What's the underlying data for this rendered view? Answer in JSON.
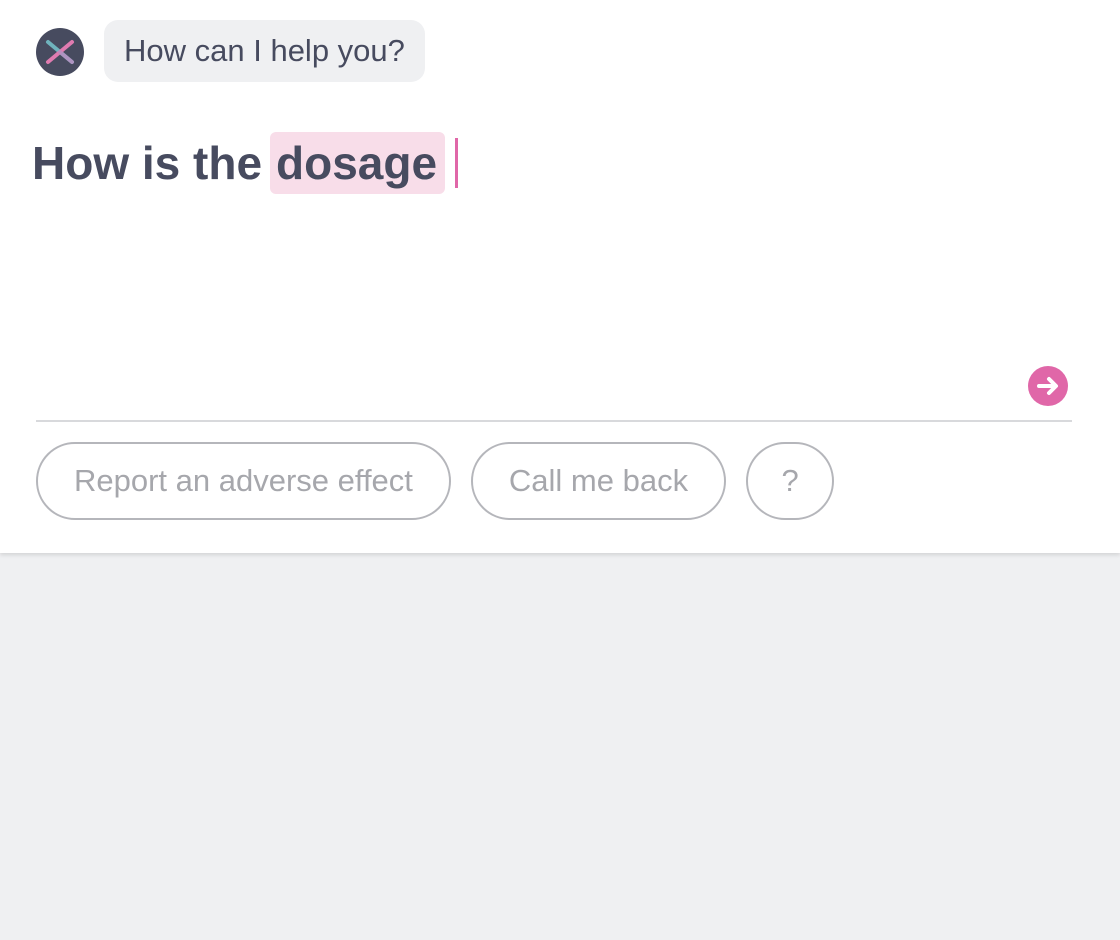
{
  "assistant": {
    "avatar_icon": "brand-x-logo-icon",
    "greeting": "How can I help you?"
  },
  "query": {
    "text": "How is the",
    "highlighted_term": "dosage",
    "highlight_color": "#f8dde9",
    "caret_color": "#e067a8"
  },
  "send": {
    "icon": "arrow-right-icon",
    "color": "#e067a8"
  },
  "suggestions": [
    {
      "label": "Report an adverse effect"
    },
    {
      "label": "Call me back"
    },
    {
      "label": "?"
    }
  ],
  "colors": {
    "text": "#474b5f",
    "chip_text": "#a6a7ac",
    "background": "#eff0f2"
  }
}
